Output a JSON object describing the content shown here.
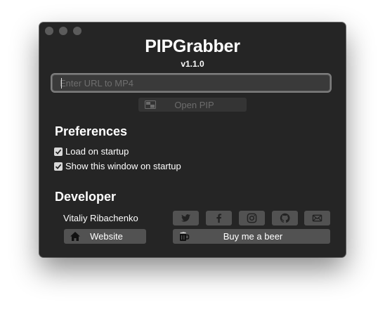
{
  "app": {
    "title": "PIPGrabber",
    "version": "v1.1.0"
  },
  "url_input": {
    "placeholder": "Enter URL to MP4",
    "value": ""
  },
  "open_pip": {
    "label": "Open PIP",
    "enabled": false,
    "icon": "pip-icon"
  },
  "preferences": {
    "heading": "Preferences",
    "options": [
      {
        "label": "Load on startup",
        "checked": true
      },
      {
        "label": "Show this window on startup",
        "checked": true
      }
    ]
  },
  "developer": {
    "heading": "Developer",
    "name": "Vitaliy Ribachenko",
    "social": [
      "twitter-icon",
      "facebook-icon",
      "instagram-icon",
      "github-icon",
      "mail-icon"
    ],
    "website_label": "Website",
    "website_icon": "home-icon",
    "beer_label": "Buy me a beer",
    "beer_icon": "beer-mug-icon"
  },
  "colors": {
    "window_bg": "#252525",
    "button_bg": "#525252",
    "disabled_text": "#6c6c6c",
    "text": "#ffffff"
  }
}
